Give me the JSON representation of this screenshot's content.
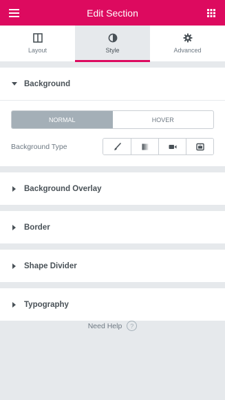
{
  "header": {
    "title": "Edit Section",
    "menu_icon": "hamburger-icon",
    "apps_icon": "grid-icon"
  },
  "tabs": [
    {
      "label": "Layout",
      "icon": "columns-icon",
      "active": false
    },
    {
      "label": "Style",
      "icon": "contrast-icon",
      "active": true
    },
    {
      "label": "Advanced",
      "icon": "gear-icon",
      "active": false
    }
  ],
  "background_section": {
    "title": "Background",
    "state_switch": {
      "normal": "NORMAL",
      "hover": "HOVER",
      "selected": "NORMAL"
    },
    "type_label": "Background Type",
    "type_options": [
      "brush-icon",
      "gradient-icon",
      "video-icon",
      "slideshow-icon"
    ]
  },
  "collapsed_sections": [
    {
      "title": "Background Overlay"
    },
    {
      "title": "Border"
    },
    {
      "title": "Shape Divider"
    },
    {
      "title": "Typography"
    }
  ],
  "footer": {
    "help_text": "Need Help",
    "help_icon": "question-circle-icon"
  },
  "colors": {
    "accent": "#dd0a5f",
    "panel_bg": "#e6e9ec",
    "active_switch": "#a4afb7"
  }
}
